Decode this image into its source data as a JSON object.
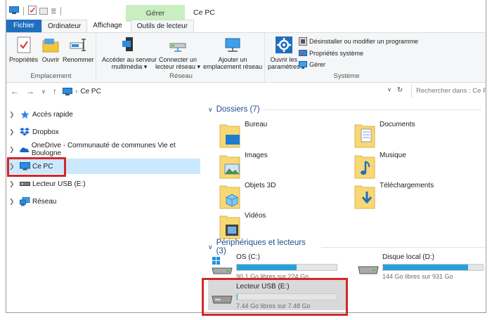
{
  "window": {
    "title": "Ce PC",
    "context_group": "Gérer"
  },
  "tabs": {
    "fichier": "Fichier",
    "ordinateur": "Ordinateur",
    "affichage": "Affichage",
    "outils": "Outils de lecteur"
  },
  "ribbon": {
    "emplacement": {
      "label": "Emplacement",
      "proprietes": "Propriétés",
      "ouvrir": "Ouvrir",
      "renommer": "Renommer"
    },
    "reseau": {
      "label": "Réseau",
      "acceder": [
        "Accéder au serveur",
        "multimédia ▾"
      ],
      "connecter": [
        "Connecter un",
        "lecteur réseau ▾"
      ],
      "ajouter": [
        "Ajouter un",
        "emplacement réseau"
      ]
    },
    "systeme": {
      "label": "Système",
      "ouvrir_parametres": [
        "Ouvrir les",
        "paramètres"
      ],
      "desinstaller": "Désinstaller ou modifier un programme",
      "proprietes_systeme": "Propriétés système",
      "gerer": "Gérer"
    }
  },
  "address": {
    "path": "Ce PC",
    "search_placeholder": "Rechercher dans : Ce PC"
  },
  "navpane": {
    "acces_rapide": "Accès rapide",
    "dropbox": "Dropbox",
    "onedrive": "OneDrive - Communauté de communes Vie et Boulogne",
    "ce_pc": "Ce PC",
    "usb": "Lecteur USB (E:)",
    "reseau": "Réseau"
  },
  "content": {
    "folders_header": "Dossiers (7)",
    "folders": {
      "bureau": "Bureau",
      "documents": "Documents",
      "images": "Images",
      "musique": "Musique",
      "objets3d": "Objets 3D",
      "telechargements": "Téléchargements",
      "videos": "Vidéos"
    },
    "devices_header": "Périphériques et lecteurs (3)",
    "drives": {
      "c": {
        "name": "OS (C:)",
        "free": "90.1 Go libres sur 224 Go",
        "used_fraction": 0.6
      },
      "d": {
        "name": "Disque local (D:)",
        "free": "144 Go libres sur 931 Go",
        "used_fraction": 0.85
      },
      "e": {
        "name": "Lecteur USB (E:)",
        "free": "7.44 Go libres sur 7.48 Go",
        "used_fraction": 0.01
      }
    }
  },
  "colors": {
    "accent": "#1e6fc0",
    "selection": "#cce8ff",
    "highlight_box": "#d32828",
    "drive_fill": "#26a0da"
  }
}
